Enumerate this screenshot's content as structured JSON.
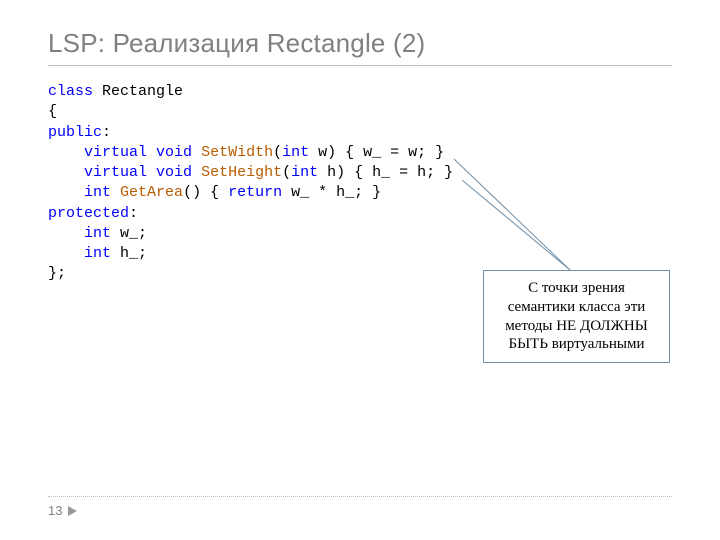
{
  "title": "LSP: Реализация Rectangle (2)",
  "code": {
    "l1_kw": "class",
    "l1_txt": " Rectangle",
    "l2": "{",
    "l3_kw": "public",
    "l3_txt": ":",
    "l4_indent": "    ",
    "l4_kw1": "virtual",
    "l4_sp1": " ",
    "l4_kw2": "void",
    "l4_sp2": " ",
    "l4_fn": "SetWidth",
    "l4_p1": "(",
    "l4_kw3": "int",
    "l4_rest": " w) { w_ = w; }",
    "l5_indent": "    ",
    "l5_kw1": "virtual",
    "l5_sp1": " ",
    "l5_kw2": "void",
    "l5_sp2": " ",
    "l5_fn": "SetHeight",
    "l5_p1": "(",
    "l5_kw3": "int",
    "l5_rest": " h) { h_ = h; }",
    "l6_indent": "    ",
    "l6_kw1": "int",
    "l6_sp1": " ",
    "l6_fn": "GetArea",
    "l6_p1": "() { ",
    "l6_kw2": "return",
    "l6_rest": " w_ * h_; }",
    "l7_kw": "protected",
    "l7_txt": ":",
    "l8_indent": "    ",
    "l8_kw": "int",
    "l8_rest": " w_;",
    "l9_indent": "    ",
    "l9_kw": "int",
    "l9_rest": " h_;",
    "l10": "};"
  },
  "callout_text": "С точки зрения семантики класса эти методы НЕ ДОЛЖНЫ БЫТЬ виртуальными",
  "page_number": "13"
}
